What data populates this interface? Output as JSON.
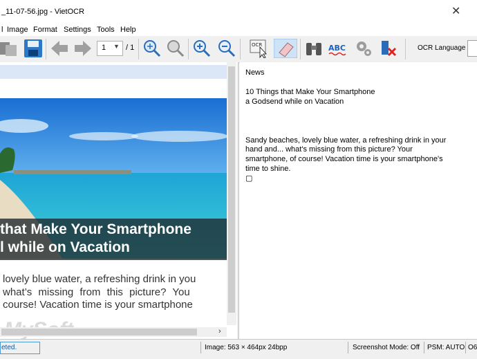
{
  "window": {
    "title": "_11-07-56.jpg - VietOCR"
  },
  "menu": {
    "items": [
      "l",
      "Image",
      "Format",
      "Settings",
      "Tools",
      "Help"
    ]
  },
  "toolbar": {
    "page_value": "1",
    "page_total": "/ 1",
    "ocr_language_label": "OCR Language"
  },
  "image_panel": {
    "headline": [
      "that Make Your Smartphone",
      "l while on Vacation"
    ],
    "body": [
      "lovely blue water, a refreshing drink in you",
      "what’s missing from this picture? You",
      "course! Vacation time is your smartphone"
    ],
    "watermark": "MySoft"
  },
  "text_panel": {
    "lines": [
      "News",
      "10 Things that Make Your Smartphone",
      "a Godsend while on Vacation",
      "Sandy beaches, lovely blue water, a refreshing drink in your",
      "hand and... what's missing from this picture? Your",
      "smartphone, of course! Vacation time is your smartphone's",
      "time to shine.",
      "▢"
    ]
  },
  "status": {
    "progress_text": "eted.",
    "image_info": "Image: 563 × 464px  24bpp",
    "screenshot_mode": "Screenshot Mode: Off",
    "psm": "PSM: AUTO",
    "extra": "O6"
  }
}
